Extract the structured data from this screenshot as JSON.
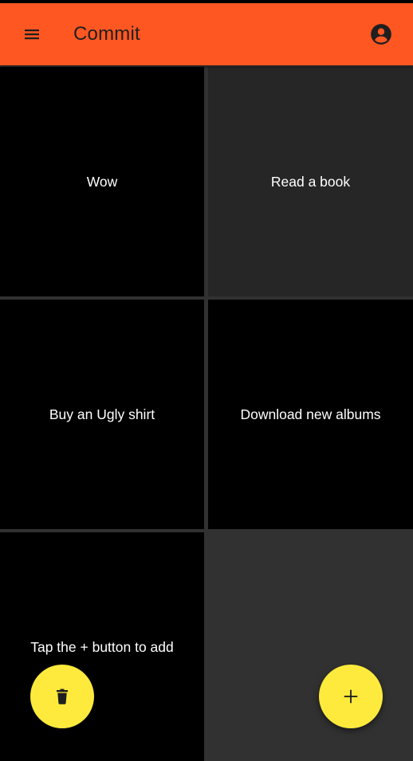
{
  "app_bar": {
    "title": "Commit",
    "menu_icon": "menu-icon",
    "account_icon": "account-circle-icon",
    "color": "#ff5722"
  },
  "cards": [
    {
      "label": "Wow",
      "color": "#000000"
    },
    {
      "label": "Read a book",
      "color": "#262626"
    },
    {
      "label": "Buy an Ugly shirt",
      "color": "#000000"
    },
    {
      "label": "Download new albums",
      "color": "#000000"
    },
    {
      "label": "Tap the + button to add",
      "color": "#000000"
    }
  ],
  "fabs": {
    "delete_icon": "trash-icon",
    "add_icon": "plus-icon",
    "color": "#fdea3c"
  },
  "background": "#313131"
}
